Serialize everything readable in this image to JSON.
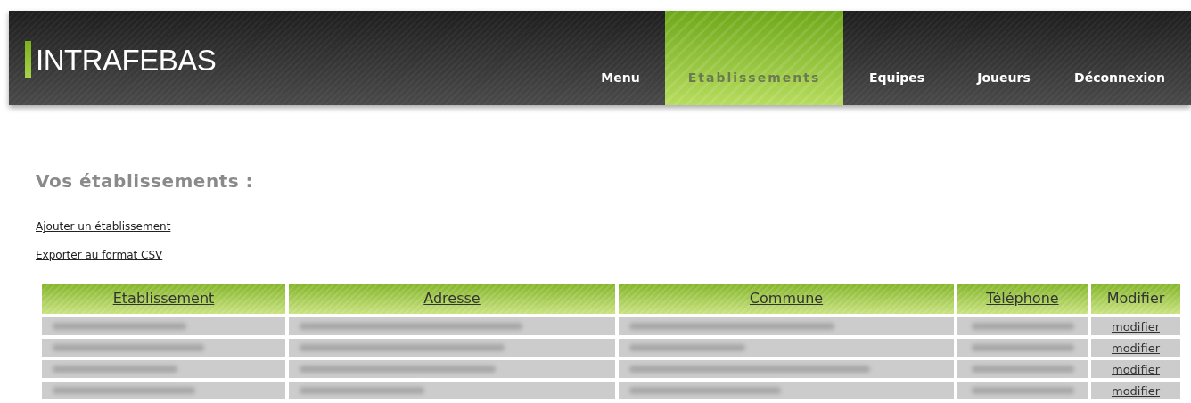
{
  "header": {
    "logo": "INTRAFEBAS",
    "nav": [
      {
        "label": "Menu",
        "selected": false
      },
      {
        "label": "Etablissements",
        "selected": true
      },
      {
        "label": "Equipes",
        "selected": false
      },
      {
        "label": "Joueurs",
        "selected": false
      },
      {
        "label": "Déconnexion",
        "selected": false
      }
    ]
  },
  "page_title": "Vos établissements :",
  "links": [
    "Ajouter un établissement",
    "Exporter au format CSV"
  ],
  "table": {
    "columns": [
      {
        "label": "Etablissement",
        "sortable": true
      },
      {
        "label": "Adresse",
        "sortable": true
      },
      {
        "label": "Commune",
        "sortable": true
      },
      {
        "label": "Téléphone",
        "sortable": true
      },
      {
        "label": "Modifier",
        "sortable": false
      }
    ],
    "rows": [
      {
        "action": "modifier"
      },
      {
        "action": "modifier"
      },
      {
        "action": "modifier"
      },
      {
        "action": "modifier"
      }
    ]
  }
}
